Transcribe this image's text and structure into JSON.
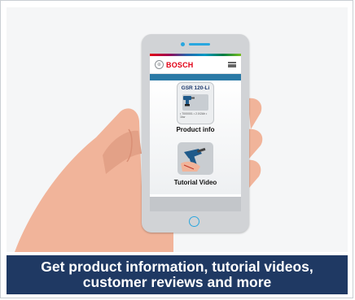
{
  "app": {
    "brand": "BOSCH",
    "menu_icon": "hamburger-menu-icon",
    "logo_icon": "bosch-armature-logo-icon"
  },
  "product_card": {
    "model": "GSR 120-Li",
    "spec": "• 7000001 • 2.0/2Ah • 1kw",
    "label": "Product info"
  },
  "tutorial": {
    "label": "Tutorial Video"
  },
  "caption": {
    "line1": "Get product information, tutorial videos,",
    "line2": "customer reviews and more"
  },
  "colors": {
    "caption_bg": "#1f3963",
    "brand_red": "#e20015",
    "accent_blue": "#2aa7df",
    "app_band": "#2b7aa6"
  }
}
